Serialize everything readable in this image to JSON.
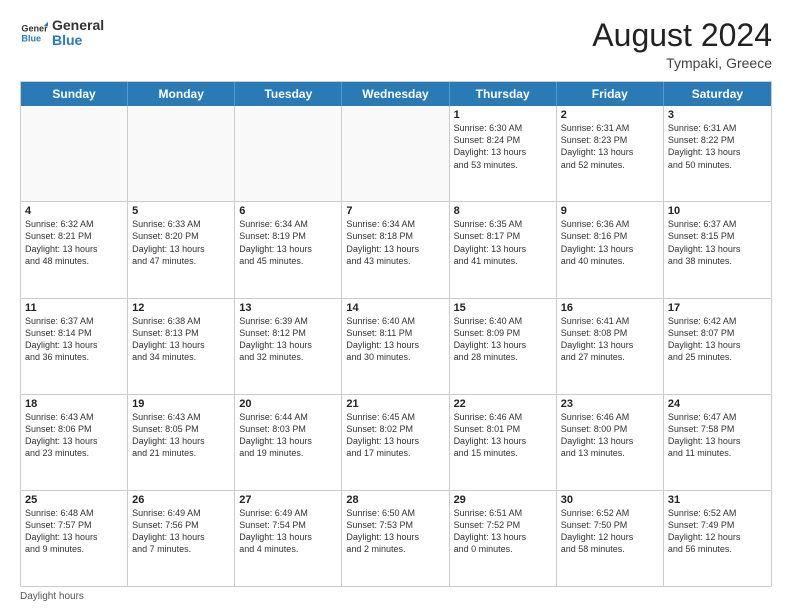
{
  "header": {
    "logo_general": "General",
    "logo_blue": "Blue",
    "month_year": "August 2024",
    "location": "Tympaki, Greece"
  },
  "days_of_week": [
    "Sunday",
    "Monday",
    "Tuesday",
    "Wednesday",
    "Thursday",
    "Friday",
    "Saturday"
  ],
  "weeks": [
    [
      {
        "day": "",
        "text": "",
        "empty": true
      },
      {
        "day": "",
        "text": "",
        "empty": true
      },
      {
        "day": "",
        "text": "",
        "empty": true
      },
      {
        "day": "",
        "text": "",
        "empty": true
      },
      {
        "day": "1",
        "text": "Sunrise: 6:30 AM\nSunset: 8:24 PM\nDaylight: 13 hours\nand 53 minutes.",
        "empty": false
      },
      {
        "day": "2",
        "text": "Sunrise: 6:31 AM\nSunset: 8:23 PM\nDaylight: 13 hours\nand 52 minutes.",
        "empty": false
      },
      {
        "day": "3",
        "text": "Sunrise: 6:31 AM\nSunset: 8:22 PM\nDaylight: 13 hours\nand 50 minutes.",
        "empty": false
      }
    ],
    [
      {
        "day": "4",
        "text": "Sunrise: 6:32 AM\nSunset: 8:21 PM\nDaylight: 13 hours\nand 48 minutes.",
        "empty": false
      },
      {
        "day": "5",
        "text": "Sunrise: 6:33 AM\nSunset: 8:20 PM\nDaylight: 13 hours\nand 47 minutes.",
        "empty": false
      },
      {
        "day": "6",
        "text": "Sunrise: 6:34 AM\nSunset: 8:19 PM\nDaylight: 13 hours\nand 45 minutes.",
        "empty": false
      },
      {
        "day": "7",
        "text": "Sunrise: 6:34 AM\nSunset: 8:18 PM\nDaylight: 13 hours\nand 43 minutes.",
        "empty": false
      },
      {
        "day": "8",
        "text": "Sunrise: 6:35 AM\nSunset: 8:17 PM\nDaylight: 13 hours\nand 41 minutes.",
        "empty": false
      },
      {
        "day": "9",
        "text": "Sunrise: 6:36 AM\nSunset: 8:16 PM\nDaylight: 13 hours\nand 40 minutes.",
        "empty": false
      },
      {
        "day": "10",
        "text": "Sunrise: 6:37 AM\nSunset: 8:15 PM\nDaylight: 13 hours\nand 38 minutes.",
        "empty": false
      }
    ],
    [
      {
        "day": "11",
        "text": "Sunrise: 6:37 AM\nSunset: 8:14 PM\nDaylight: 13 hours\nand 36 minutes.",
        "empty": false
      },
      {
        "day": "12",
        "text": "Sunrise: 6:38 AM\nSunset: 8:13 PM\nDaylight: 13 hours\nand 34 minutes.",
        "empty": false
      },
      {
        "day": "13",
        "text": "Sunrise: 6:39 AM\nSunset: 8:12 PM\nDaylight: 13 hours\nand 32 minutes.",
        "empty": false
      },
      {
        "day": "14",
        "text": "Sunrise: 6:40 AM\nSunset: 8:11 PM\nDaylight: 13 hours\nand 30 minutes.",
        "empty": false
      },
      {
        "day": "15",
        "text": "Sunrise: 6:40 AM\nSunset: 8:09 PM\nDaylight: 13 hours\nand 28 minutes.",
        "empty": false
      },
      {
        "day": "16",
        "text": "Sunrise: 6:41 AM\nSunset: 8:08 PM\nDaylight: 13 hours\nand 27 minutes.",
        "empty": false
      },
      {
        "day": "17",
        "text": "Sunrise: 6:42 AM\nSunset: 8:07 PM\nDaylight: 13 hours\nand 25 minutes.",
        "empty": false
      }
    ],
    [
      {
        "day": "18",
        "text": "Sunrise: 6:43 AM\nSunset: 8:06 PM\nDaylight: 13 hours\nand 23 minutes.",
        "empty": false
      },
      {
        "day": "19",
        "text": "Sunrise: 6:43 AM\nSunset: 8:05 PM\nDaylight: 13 hours\nand 21 minutes.",
        "empty": false
      },
      {
        "day": "20",
        "text": "Sunrise: 6:44 AM\nSunset: 8:03 PM\nDaylight: 13 hours\nand 19 minutes.",
        "empty": false
      },
      {
        "day": "21",
        "text": "Sunrise: 6:45 AM\nSunset: 8:02 PM\nDaylight: 13 hours\nand 17 minutes.",
        "empty": false
      },
      {
        "day": "22",
        "text": "Sunrise: 6:46 AM\nSunset: 8:01 PM\nDaylight: 13 hours\nand 15 minutes.",
        "empty": false
      },
      {
        "day": "23",
        "text": "Sunrise: 6:46 AM\nSunset: 8:00 PM\nDaylight: 13 hours\nand 13 minutes.",
        "empty": false
      },
      {
        "day": "24",
        "text": "Sunrise: 6:47 AM\nSunset: 7:58 PM\nDaylight: 13 hours\nand 11 minutes.",
        "empty": false
      }
    ],
    [
      {
        "day": "25",
        "text": "Sunrise: 6:48 AM\nSunset: 7:57 PM\nDaylight: 13 hours\nand 9 minutes.",
        "empty": false
      },
      {
        "day": "26",
        "text": "Sunrise: 6:49 AM\nSunset: 7:56 PM\nDaylight: 13 hours\nand 7 minutes.",
        "empty": false
      },
      {
        "day": "27",
        "text": "Sunrise: 6:49 AM\nSunset: 7:54 PM\nDaylight: 13 hours\nand 4 minutes.",
        "empty": false
      },
      {
        "day": "28",
        "text": "Sunrise: 6:50 AM\nSunset: 7:53 PM\nDaylight: 13 hours\nand 2 minutes.",
        "empty": false
      },
      {
        "day": "29",
        "text": "Sunrise: 6:51 AM\nSunset: 7:52 PM\nDaylight: 13 hours\nand 0 minutes.",
        "empty": false
      },
      {
        "day": "30",
        "text": "Sunrise: 6:52 AM\nSunset: 7:50 PM\nDaylight: 12 hours\nand 58 minutes.",
        "empty": false
      },
      {
        "day": "31",
        "text": "Sunrise: 6:52 AM\nSunset: 7:49 PM\nDaylight: 12 hours\nand 56 minutes.",
        "empty": false
      }
    ]
  ],
  "footer": {
    "note": "Daylight hours"
  }
}
